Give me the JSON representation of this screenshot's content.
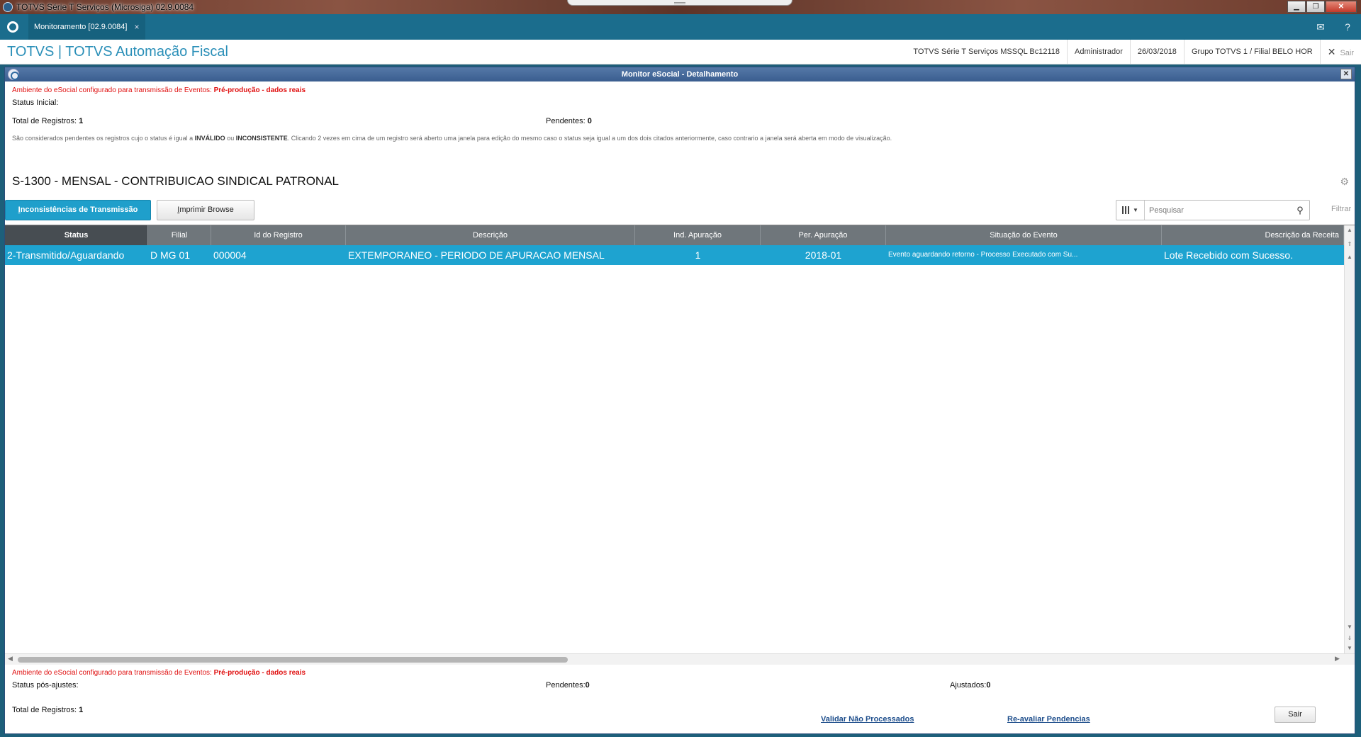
{
  "os_window": {
    "title": "TOTVS Série T Serviços (Microsiga) 02.9.0084"
  },
  "tabbar": {
    "tab_label": "Monitoramento [02.9.0084]",
    "tab_close": "×"
  },
  "header": {
    "brand": "TOTVS | TOTVS Automação Fiscal",
    "environment": "TOTVS Série T Serviços MSSQL Bc12118",
    "user": "Administrador",
    "date": "26/03/2018",
    "company": "Grupo TOTVS 1 / Filial BELO HOR",
    "exit": "Sair"
  },
  "dialog": {
    "title": "Monitor eSocial - Detalhamento",
    "top": {
      "warning_prefix": "Ambiente do eSocial configurado para transmissão de Eventos: ",
      "warning_value": "Pré-produção - dados reais",
      "status_label": "Status Inicial:",
      "total_label": "Total de Registros: ",
      "total_value": "1",
      "pending_label": "Pendentes: ",
      "pending_value": "0",
      "note_1": "São considerados pendentes os registros cujo o status é igual a ",
      "note_invalid": "INVÁLIDO",
      "note_2": " ou ",
      "note_inconsistent": "INCONSISTENTE",
      "note_3": ". Clicando 2 vezes em cima de um registro será aberto uma janela para edição do mesmo caso o status seja igual a um dos dois citados anteriormente, caso contrario a janela será aberta em modo de visualização."
    },
    "event_title": "S-1300 - MENSAL - CONTRIBUICAO SINDICAL PATRONAL",
    "buttons": {
      "inconsistencias_first": "I",
      "inconsistencias_rest": "nconsistências de Transmissão",
      "imprimir_first": "I",
      "imprimir_rest": "mprimir Browse"
    },
    "search": {
      "placeholder": "Pesquisar",
      "filter_label": "Filtrar"
    },
    "grid": {
      "columns": [
        "Status",
        "Filial",
        "Id do Registro",
        "Descrição",
        "Ind. Apuração",
        "Per. Apuração",
        "Situação do Evento",
        "Descrição da Receita"
      ],
      "rows": [
        [
          "2-Transmitido/Aguardando",
          "D MG 01",
          "000004",
          "EXTEMPORANEO - PERIODO DE APURACAO MENSAL",
          "1",
          "2018-01",
          "Evento aguardando retorno - Processo Executado com Su...",
          "Lote Recebido com Sucesso."
        ]
      ]
    },
    "bottom": {
      "warning_prefix": "Ambiente do eSocial configurado para transmissão de Eventos: ",
      "warning_value": "Pré-produção - dados reais",
      "status_label": "Status pós-ajustes:",
      "pending_label": "Pendentes:",
      "pending_value": "0",
      "adjusted_label": "Ajustados:",
      "adjusted_value": "0",
      "total_label": "Total de Registros: ",
      "total_value": "1",
      "validate_link": "Validar Não Processados",
      "reevaluate_link": "Re-avaliar Pendencias",
      "exit_button": "Sair"
    }
  },
  "colors": {
    "accent": "#1ea3d0",
    "tabbar": "#1b6d8d",
    "brand": "#2a8fb8",
    "warning": "#e01010",
    "grid_header": "#6f767b"
  }
}
